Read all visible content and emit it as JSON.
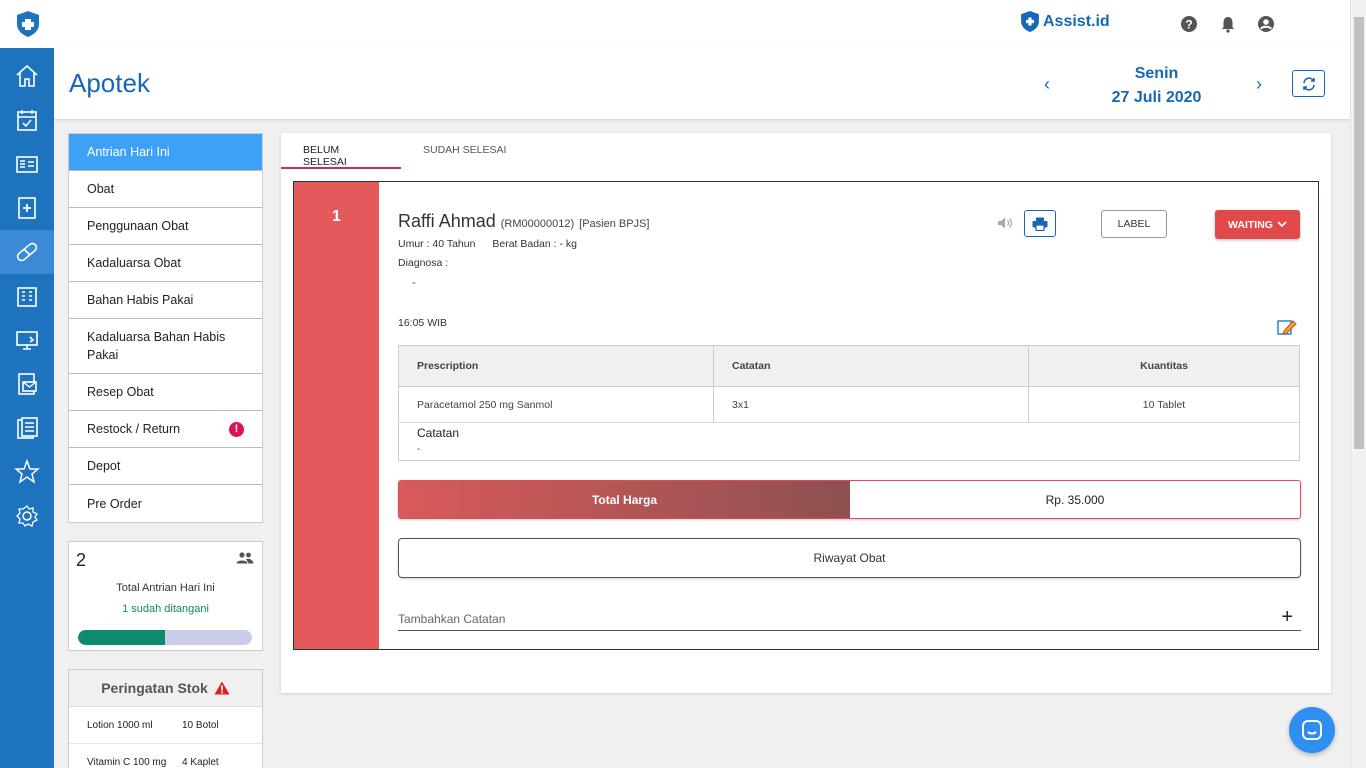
{
  "brand": {
    "name": "Assist.id"
  },
  "header": {
    "title": "Apotek",
    "day": "Senin",
    "date": "27 Juli 2020"
  },
  "rail": {
    "items": [
      "home-icon",
      "calendar-check-icon",
      "id-card-icon",
      "medical-record-icon",
      "pill-icon",
      "building-icon",
      "monitor-icon",
      "mail-icon",
      "clipboard-icon",
      "star-icon",
      "settings-icon"
    ],
    "active_index": 4
  },
  "menu": {
    "items": [
      {
        "label": "Antrian Hari Ini"
      },
      {
        "label": "Obat"
      },
      {
        "label": "Penggunaan Obat"
      },
      {
        "label": "Kadaluarsa Obat"
      },
      {
        "label": "Bahan Habis Pakai"
      },
      {
        "label": "Kadaluarsa Bahan Habis Pakai"
      },
      {
        "label": "Resep Obat"
      },
      {
        "label": "Restock / Return",
        "badge": "!"
      },
      {
        "label": "Depot"
      },
      {
        "label": "Pre Order"
      }
    ]
  },
  "queue": {
    "count": "2",
    "label": "Total Antrian Hari Ini",
    "handled": "1 sudah ditangani",
    "progress_fraction": 0.5
  },
  "stock": {
    "title": "Peringatan Stok",
    "rows": [
      {
        "name": "Lotion 1000 ml",
        "qty": "10 Botol"
      },
      {
        "name": "Vitamin C 100 mg",
        "qty": "4 Kaplet"
      }
    ]
  },
  "tabs": [
    "BELUM SELESAI",
    "SUDAH SELESAI"
  ],
  "patient": {
    "queue_number": "1",
    "name": "Raffi Ahmad",
    "record": "(RM00000012)",
    "type": "[Pasien BPJS]",
    "age": "Umur : 40 Tahun",
    "weight": "Berat Badan : - kg",
    "diagnosis_label": "Diagnosa :",
    "diagnosis_value": "-",
    "time": "16:05 WIB",
    "label_button": "LABEL",
    "status_button": "WAITING"
  },
  "prescription": {
    "headers": [
      "Prescription",
      "Catatan",
      "Kuantitas"
    ],
    "rows": [
      {
        "name": "Paracetamol 250 mg Sanmol",
        "note": "3x1",
        "qty": "10 Tablet"
      }
    ],
    "note_label": "Catatan",
    "note_value": "-"
  },
  "total": {
    "label": "Total Harga",
    "value": "Rp. 35.000"
  },
  "history_button": "Riwayat Obat",
  "add_note_placeholder": "Tambahkan Catatan",
  "colors": {
    "primary": "#1767b8",
    "rail": "#1e73be",
    "active_menu": "#3da1f5",
    "queue_strip": "#e45a5a",
    "waiting": "#e04a4a",
    "progress": "#0e8a6e"
  }
}
